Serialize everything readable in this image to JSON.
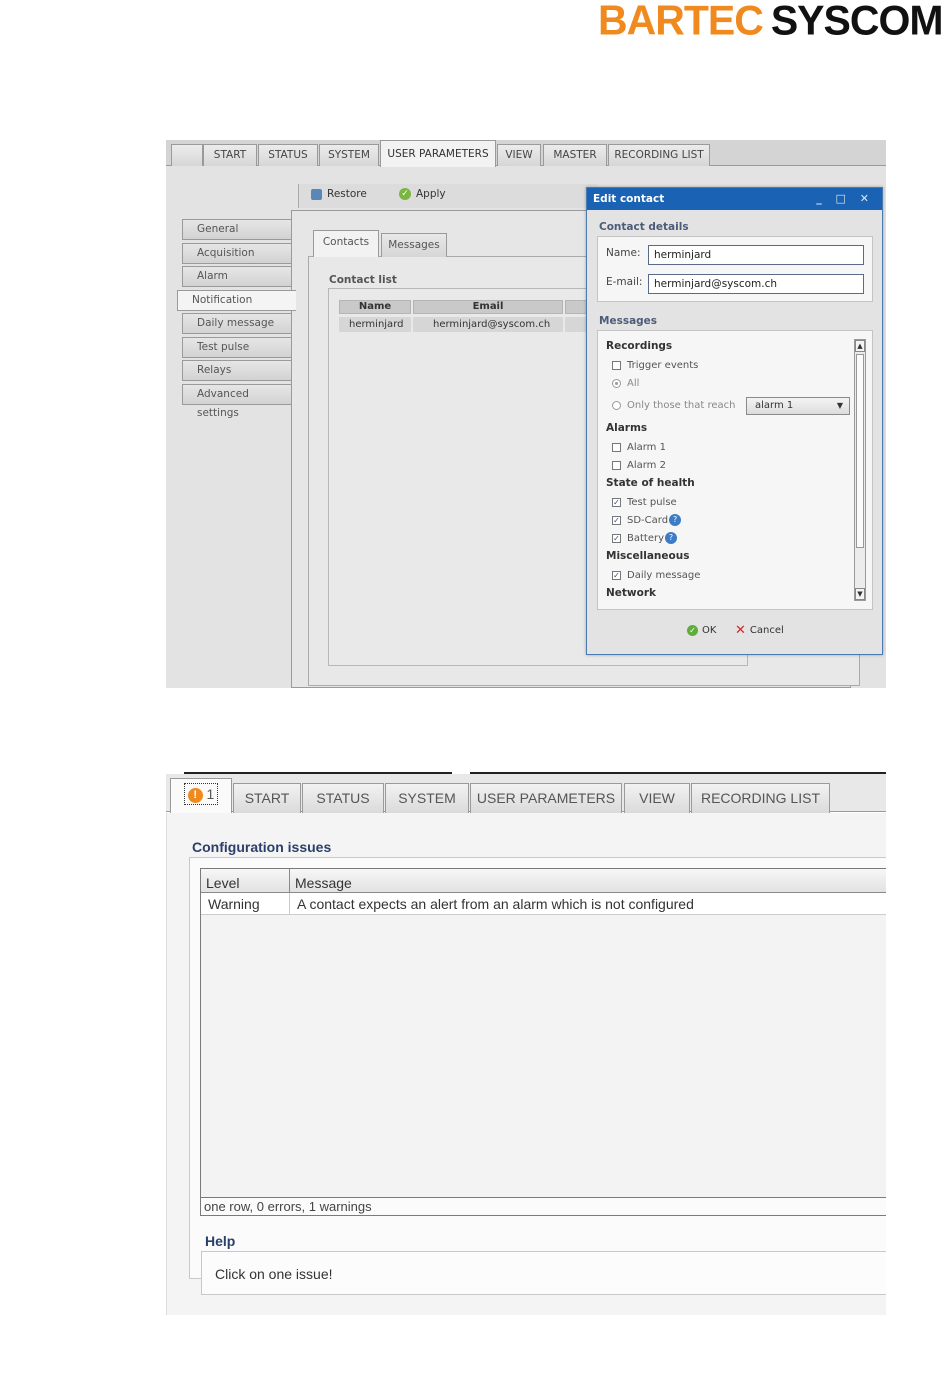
{
  "brand": {
    "part1": "BARTEC",
    "part2": "SYSCOM"
  },
  "shot1": {
    "tabs": [
      "",
      "START",
      "STATUS",
      "SYSTEM",
      "USER PARAMETERS",
      "VIEW",
      "MASTER",
      "RECORDING LIST"
    ],
    "active_tab": "USER PARAMETERS",
    "toolbar": {
      "restore": "Restore",
      "apply": "Apply"
    },
    "side_menu": [
      "General",
      "Acquisition",
      "Alarm",
      "Notification",
      "Daily message",
      "Test pulse",
      "Relays",
      "Advanced settings"
    ],
    "active_side": "Notification",
    "subtabs": [
      "Contacts",
      "Messages"
    ],
    "contact_list_label": "Contact list",
    "grid": {
      "columns": [
        "Name",
        "Email"
      ],
      "rows": [
        {
          "name": "herminjard",
          "email": "herminjard@syscom.ch"
        }
      ]
    },
    "dialog": {
      "title": "Edit contact",
      "controls": "_ □ ✕",
      "contact_details_label": "Contact details",
      "name_label": "Name:",
      "name_value": "herminjard",
      "email_label": "E-mail:",
      "email_value": "herminjard@syscom.ch",
      "messages_label": "Messages",
      "groups": {
        "recordings": "Recordings",
        "alarms": "Alarms",
        "health": "State of health",
        "misc": "Miscellaneous",
        "network": "Network"
      },
      "items": {
        "trigger_events": "Trigger events",
        "all": "All",
        "only_those": "Only those that reach",
        "alarm_select": "alarm 1",
        "alarm1": "Alarm 1",
        "alarm2": "Alarm 2",
        "test_pulse": "Test pulse",
        "sd_card": "SD-Card",
        "battery": "Battery",
        "daily_message": "Daily message"
      },
      "checked": {
        "trigger_events": false,
        "alarm1": false,
        "alarm2": false,
        "test_pulse": true,
        "sd_card": true,
        "battery": true,
        "daily_message": true
      },
      "ok": "OK",
      "cancel": "Cancel"
    }
  },
  "shot2": {
    "issue_count": "1",
    "tabs": [
      "START",
      "STATUS",
      "SYSTEM",
      "USER PARAMETERS",
      "VIEW",
      "RECORDING LIST"
    ],
    "config_title": "Configuration issues",
    "grid": {
      "columns": [
        "Level",
        "Message"
      ],
      "rows": [
        {
          "level": "Warning",
          "message": "A contact expects an alert from an alarm which is not configured"
        }
      ]
    },
    "status": "one row, 0 errors, 1 warnings",
    "help_title": "Help",
    "help_text": "Click on one issue!"
  },
  "colors": {
    "brand_orange": "#f08a1e",
    "dialog_title": "#1a62b3",
    "warning": "#f08a1e"
  }
}
